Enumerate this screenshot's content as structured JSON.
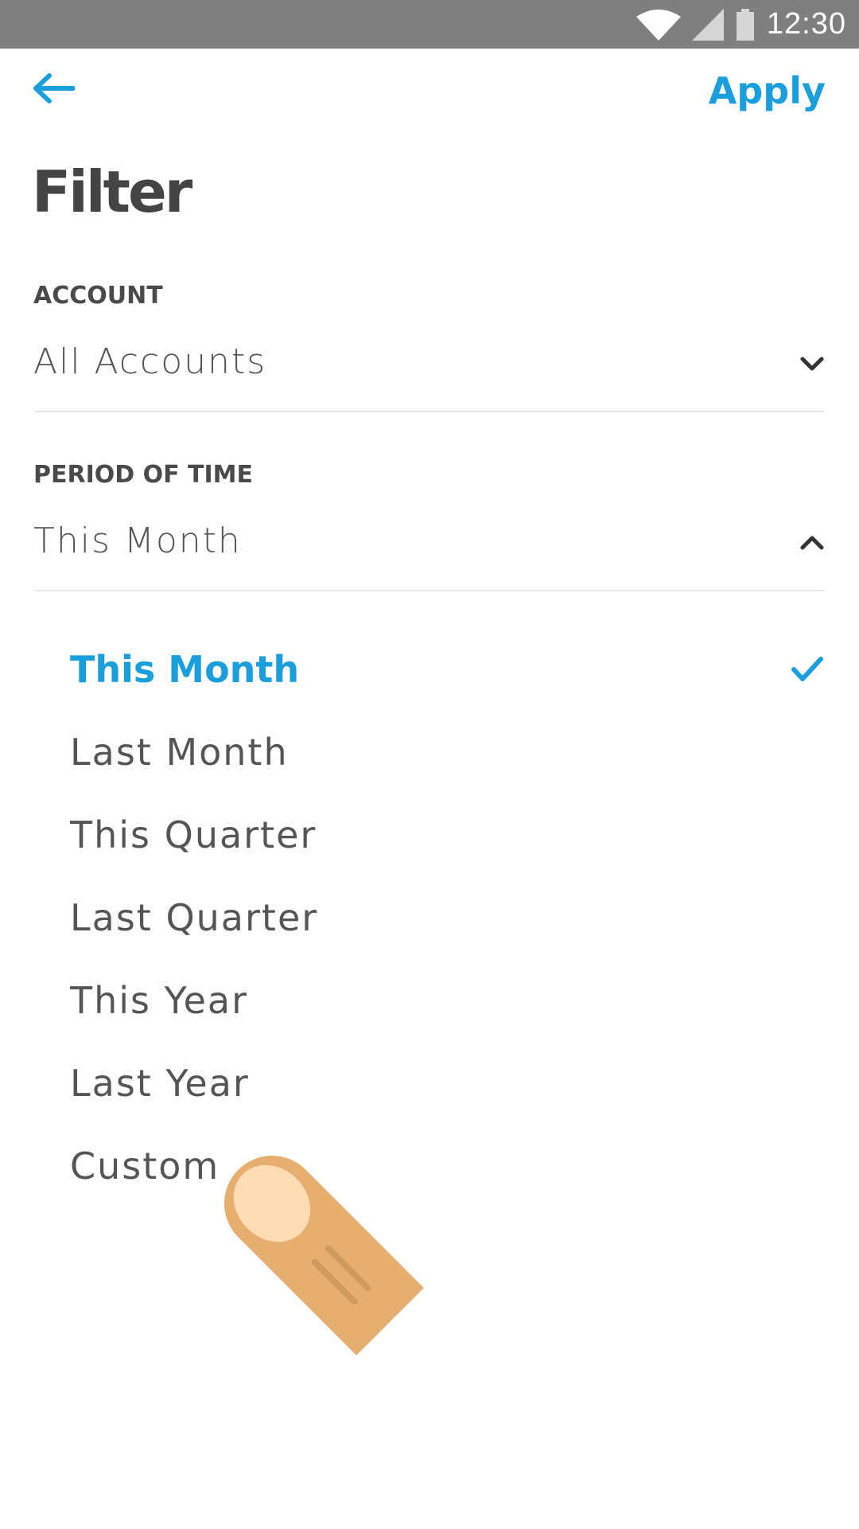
{
  "status_bar": {
    "time": "12:30",
    "icons": [
      "wifi-icon",
      "cellular-signal-icon",
      "battery-icon"
    ]
  },
  "app_bar": {
    "back_icon": "arrow-left-icon",
    "apply_label": "Apply"
  },
  "page": {
    "title": "Filter"
  },
  "account": {
    "label": "ACCOUNT",
    "selected_value": "All Accounts",
    "chevron_icon": "chevron-down-icon",
    "expanded": false
  },
  "period_of_time": {
    "label": "PERIOD OF TIME",
    "selected_value": "This Month",
    "chevron_icon": "chevron-up-icon",
    "expanded": true,
    "options": [
      {
        "label": "This Month",
        "selected": true
      },
      {
        "label": "Last Month",
        "selected": false
      },
      {
        "label": "This Quarter",
        "selected": false
      },
      {
        "label": "Last Quarter",
        "selected": false
      },
      {
        "label": "This Year",
        "selected": false
      },
      {
        "label": "Last Year",
        "selected": false
      },
      {
        "label": "Custom",
        "selected": false
      }
    ]
  },
  "overlay": {
    "pointer_icon": "finger-tap-icon"
  },
  "colors": {
    "accent": "#1a9fdc",
    "status_bar": "#7f7f7f",
    "text_primary": "#444444",
    "text_secondary": "#555555",
    "divider": "#e6e6e6",
    "finger_skin": "#e6ae6f",
    "finger_nail": "#fddcb5"
  }
}
